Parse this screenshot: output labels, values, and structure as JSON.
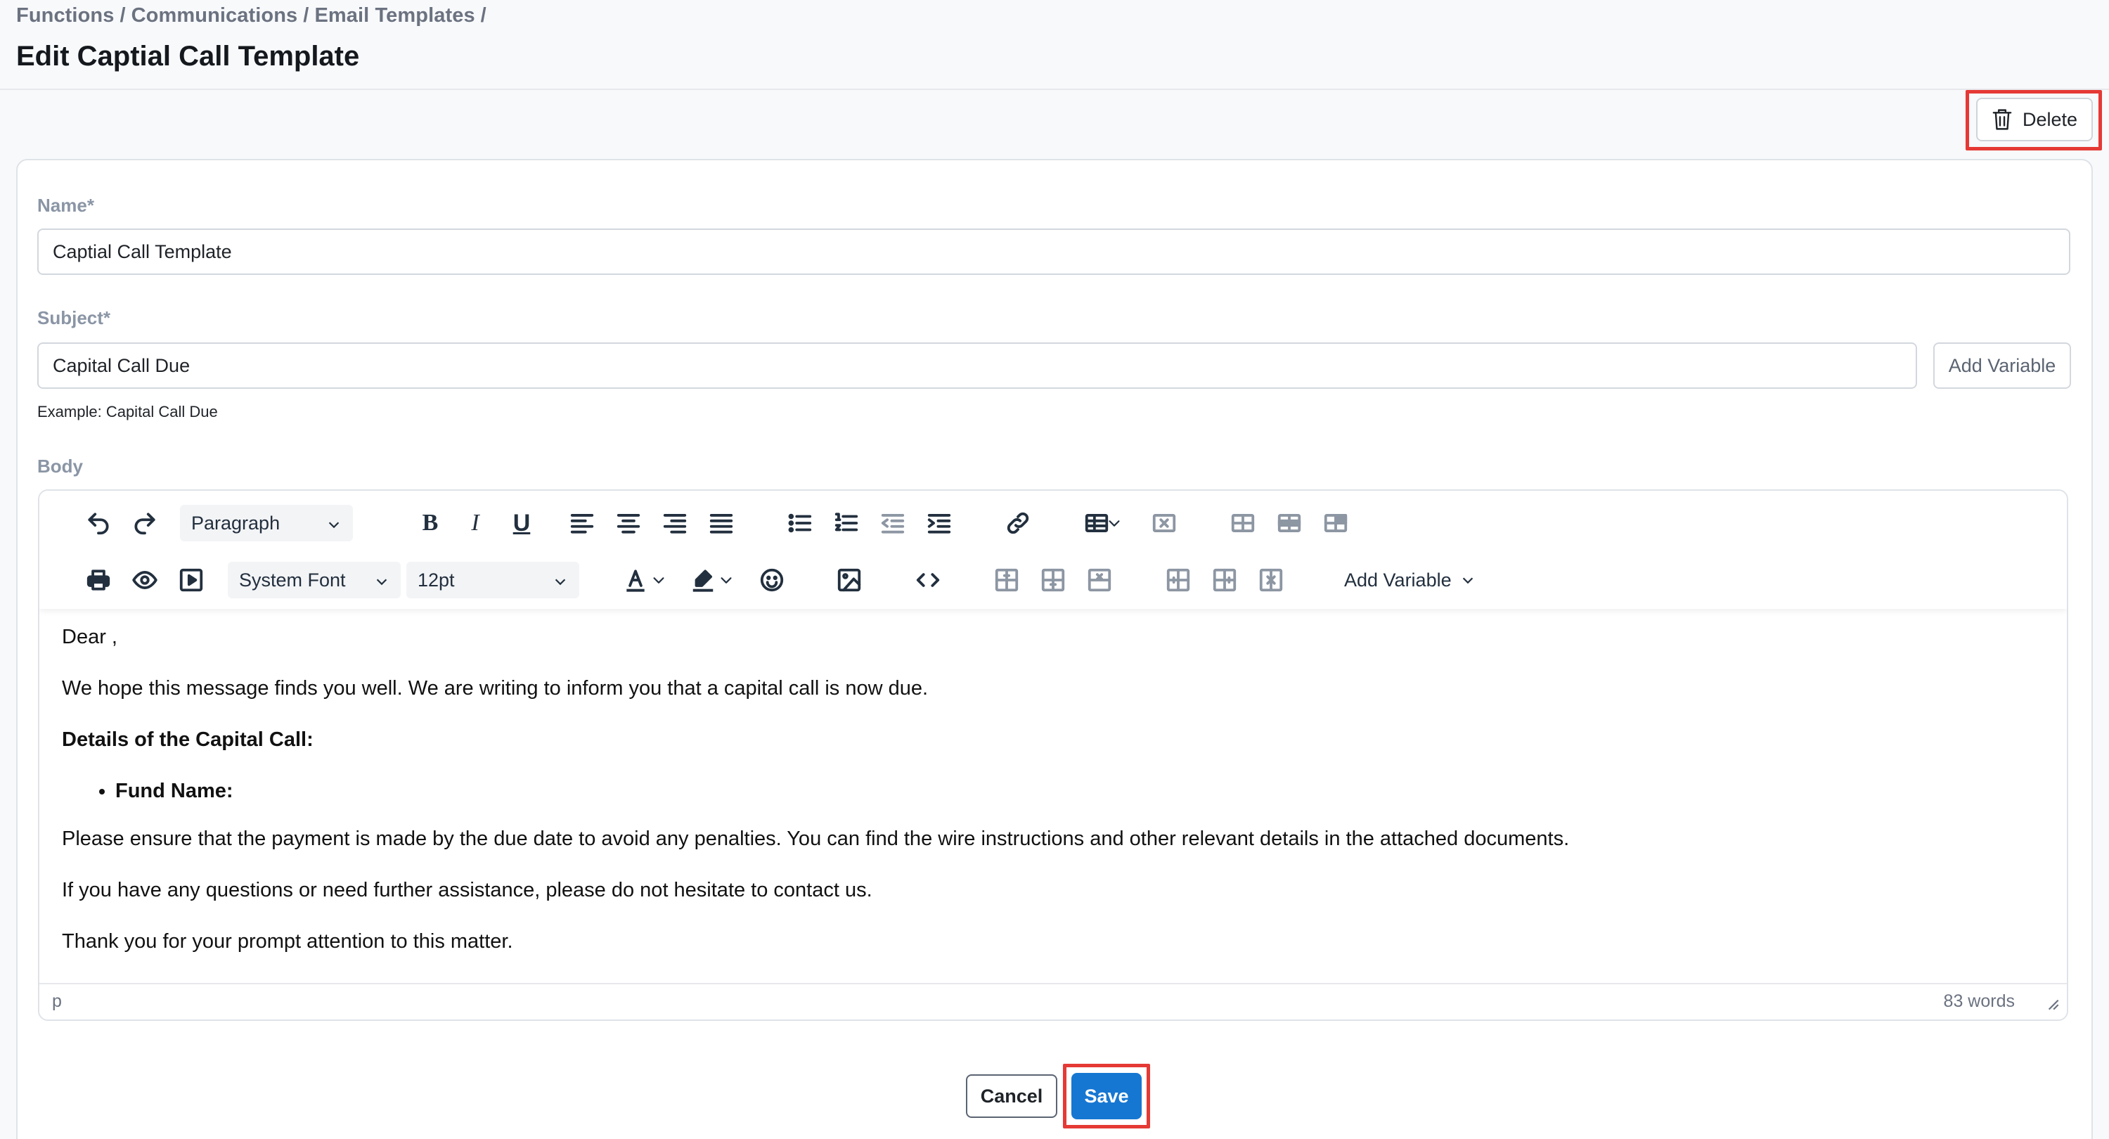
{
  "breadcrumb": {
    "items": [
      "Functions",
      "Communications",
      "Email Templates"
    ],
    "trailing_separator": "/"
  },
  "page_title": "Edit Captial Call Template",
  "header_actions": {
    "delete_label": "Delete"
  },
  "form": {
    "name": {
      "label": "Name*",
      "value": "Captial Call Template"
    },
    "subject": {
      "label": "Subject*",
      "value": "Capital Call Due",
      "helper": "Example: Capital Call Due",
      "add_variable_label": "Add Variable"
    },
    "body_label": "Body"
  },
  "editor": {
    "toolbar": {
      "block_format": "Paragraph",
      "font_family": "System Font",
      "font_size": "12pt",
      "add_variable_label": "Add Variable",
      "bold_glyph": "B",
      "italic_glyph": "I",
      "underline_glyph": "U"
    },
    "content": {
      "greeting": "Dear ,",
      "intro": "We hope this message finds you well. We are writing to inform you that a capital call is now due.",
      "details_heading": "Details of the Capital Call:",
      "bullets": [
        "Fund Name:"
      ],
      "payment_note": "Please ensure that the payment is made by the due date to avoid any penalties. You can find the wire instructions and other relevant details in the attached documents.",
      "questions_note": "If you have any questions or need further assistance, please do not hesitate to contact us.",
      "closing": "Thank you for your prompt attention to this matter."
    },
    "statusbar": {
      "path": "p",
      "word_count": "83 words"
    }
  },
  "footer": {
    "cancel_label": "Cancel",
    "save_label": "Save"
  },
  "colors": {
    "primary": "#1677d2",
    "highlight": "#e53935",
    "label": "#8a95a5"
  }
}
